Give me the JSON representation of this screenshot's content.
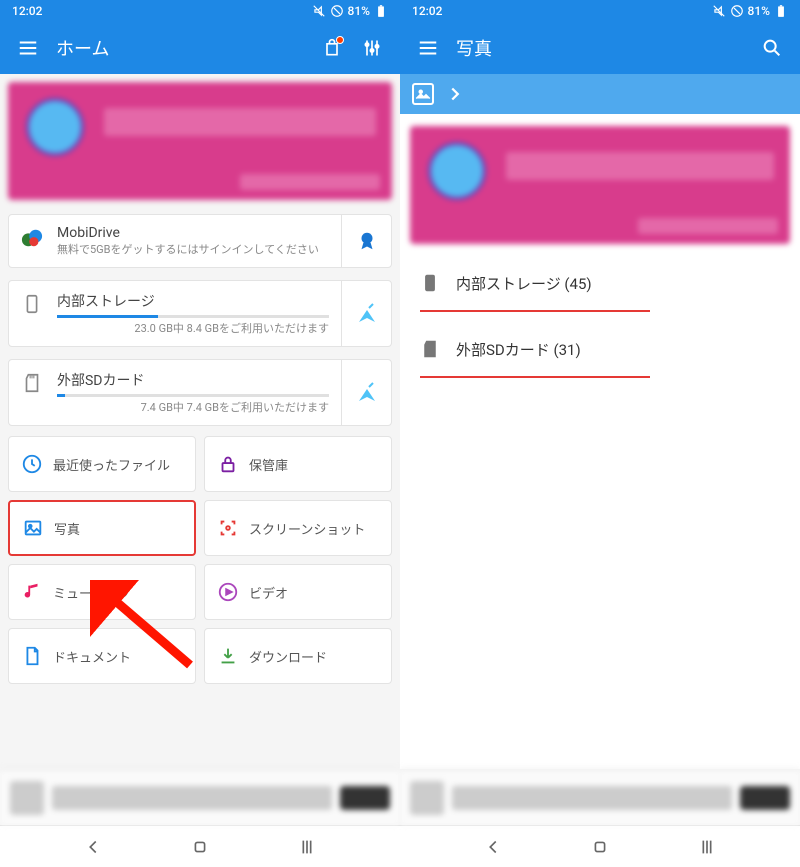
{
  "status": {
    "time": "12:02",
    "battery": "81%"
  },
  "left": {
    "title": "ホーム",
    "promo": true,
    "mobidrive": {
      "title": "MobiDrive",
      "sub": "無料で5GBをゲットするにはサインインしてください"
    },
    "storage": {
      "title": "内部ストレージ",
      "sub": "23.0 GB中 8.4 GBをご利用いただけます",
      "percent": 37
    },
    "sdcard": {
      "title": "外部SDカード",
      "sub": "7.4 GB中 7.4 GBをご利用いただけます",
      "percent": 3
    },
    "tiles": [
      {
        "label": "最近使ったファイル",
        "icon": "clock"
      },
      {
        "label": "保管庫",
        "icon": "lock"
      },
      {
        "label": "写真",
        "icon": "photo",
        "selected": true
      },
      {
        "label": "スクリーンショット",
        "icon": "capture"
      },
      {
        "label": "ミュージック",
        "icon": "music"
      },
      {
        "label": "ビデオ",
        "icon": "video"
      },
      {
        "label": "ドキュメント",
        "icon": "doc"
      },
      {
        "label": "ダウンロード",
        "icon": "download"
      }
    ]
  },
  "right": {
    "title": "写真",
    "items": [
      {
        "label": "内部ストレージ (45)",
        "icon": "phone"
      },
      {
        "label": "外部SDカード (31)",
        "icon": "sd"
      }
    ]
  }
}
